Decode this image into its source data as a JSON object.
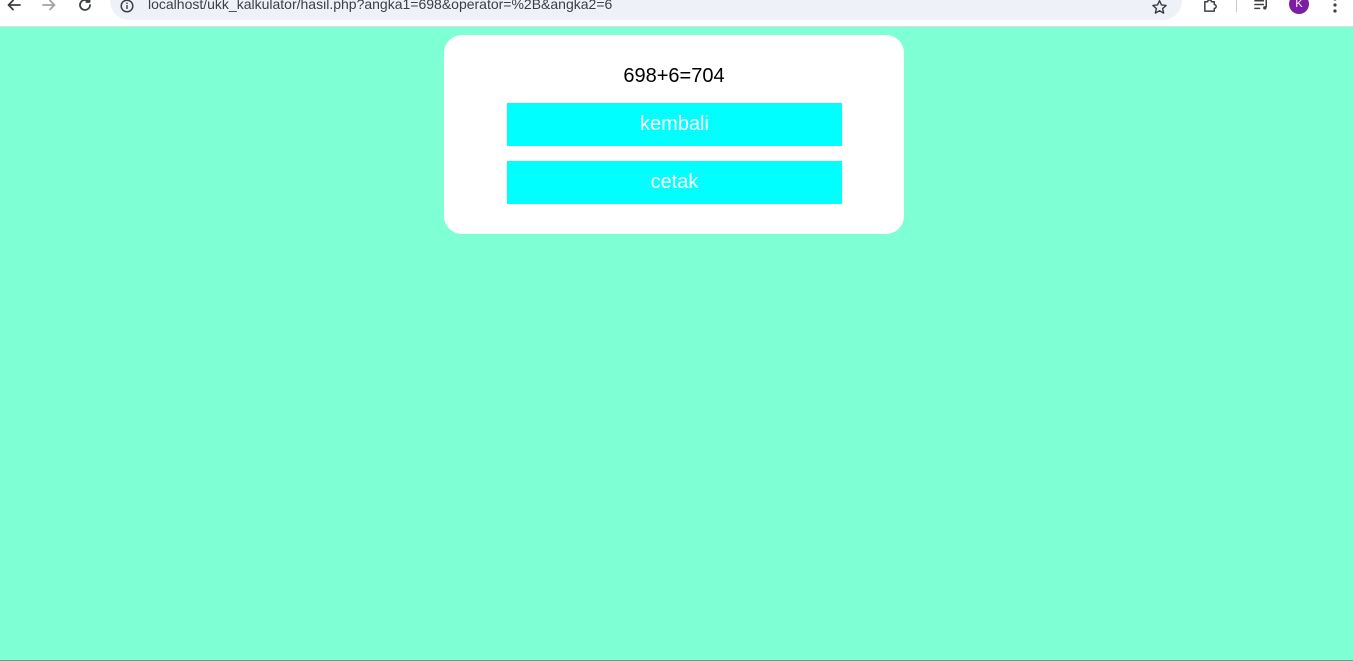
{
  "browser": {
    "url": "localhost/ukk_kalkulator/hasil.php?angka1=698&operator=%2B&angka2=6",
    "avatar_letter": "K",
    "avatar_color": "#7b1fa2",
    "icons": {
      "back": "arrow-left-icon",
      "forward": "arrow-right-icon",
      "reload": "reload-icon",
      "site_info": "info-icon",
      "bookmark": "star-icon",
      "extensions": "puzzle-icon",
      "media": "media-controls-icon",
      "menu": "kebab-menu-icon"
    }
  },
  "page": {
    "background_color": "#7fffd4",
    "card_color": "#ffffff",
    "button_color": "#00ffff",
    "result_text": "698+6=704",
    "buttons": {
      "back_label": "kembali",
      "print_label": "cetak"
    }
  }
}
